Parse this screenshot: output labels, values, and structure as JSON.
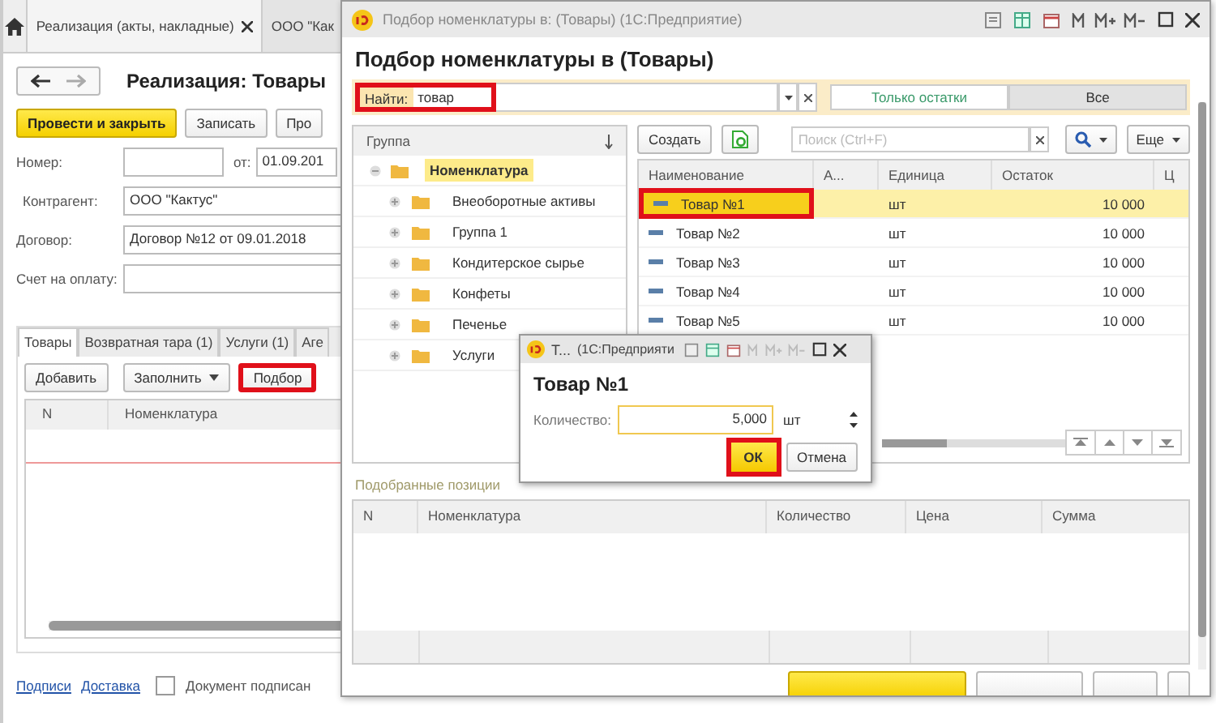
{
  "main_window": {
    "tabs": [
      {
        "label": "Реализация (акты, накладные)",
        "selected": true
      },
      {
        "label": "ООО \"Как",
        "selected": false
      }
    ],
    "title": "Реализация: Товары",
    "buttons": [
      {
        "label": "Провести и закрыть",
        "kind": "primary"
      },
      {
        "label": "Записать",
        "kind": "normal"
      },
      {
        "label": "Про",
        "kind": "normal"
      }
    ],
    "number": {
      "label": "Номер:"
    },
    "date": {
      "label": "от:",
      "value": "01.09.201"
    },
    "counterparty": {
      "label": "Контрагент:",
      "value": "ООО \"Кактус\""
    },
    "contract": {
      "label": "Договор:",
      "value": "Договор №12 от 09.01.2018"
    },
    "invoice": {
      "label": "Счет на оплату:"
    },
    "doc_tabs": [
      {
        "label": "Товары",
        "selected": true
      },
      {
        "label": "Возвратная тара (1)",
        "selected": false
      },
      {
        "label": "Услуги (1)",
        "selected": false
      },
      {
        "label": "Аге",
        "selected": false
      }
    ],
    "toolbar": [
      {
        "label": "Добавить",
        "dropdown": false,
        "highlighted": false
      },
      {
        "label": "Заполнить",
        "dropdown": true,
        "highlighted": false
      },
      {
        "label": "Подбор",
        "dropdown": false,
        "highlighted": true
      }
    ],
    "table": {
      "columns": [
        "N",
        "Номенклатура"
      ]
    },
    "links": [
      "Подписи",
      "Доставка"
    ],
    "signed": {
      "label": "Документ подписан",
      "checked": false
    }
  },
  "picker": {
    "window_title": "Подбор номенклатуры в: (Товары) (1С:Предприятие)",
    "title": "Подбор номенклатуры в  (Товары)",
    "find": {
      "label": "Найти:",
      "value": "товар",
      "highlighted": true
    },
    "filters": [
      {
        "label": "Только остатки",
        "selected": false
      },
      {
        "label": "Все",
        "selected": true
      }
    ],
    "groups": {
      "header": "Группа",
      "tree": [
        {
          "label": "Номенклатура",
          "selected": true,
          "expanded": true,
          "children": [
            {
              "label": "Внеоборотные активы",
              "selected": false,
              "expanded": false
            },
            {
              "label": "Группа 1",
              "selected": false,
              "expanded": false
            },
            {
              "label": "Кондитерское сырье",
              "selected": false,
              "expanded": false
            },
            {
              "label": "Конфеты",
              "selected": false,
              "expanded": false
            },
            {
              "label": "Печенье",
              "selected": false,
              "expanded": false
            },
            {
              "label": "Услуги",
              "selected": false,
              "expanded": false
            }
          ]
        }
      ]
    },
    "create": "Создать",
    "search_placeholder": "Поиск (Ctrl+F)",
    "more": "Еще",
    "columns": [
      "Наименование",
      "А...",
      "Единица",
      "Остаток",
      "Ц"
    ],
    "rows": [
      {
        "name": "Товар №1",
        "unit": "шт",
        "stock": "10 000",
        "selected": true,
        "highlighted": true
      },
      {
        "name": "Товар №2",
        "unit": "шт",
        "stock": "10 000",
        "selected": false,
        "highlighted": false
      },
      {
        "name": "Товар №3",
        "unit": "шт",
        "stock": "10 000",
        "selected": false,
        "highlighted": false
      },
      {
        "name": "Товар №4",
        "unit": "шт",
        "stock": "10 000",
        "selected": false,
        "highlighted": false
      },
      {
        "name": "Товар №5",
        "unit": "шт",
        "stock": "10 000",
        "selected": false,
        "highlighted": false
      }
    ],
    "picked_label": "Подобранные позиции",
    "picked_columns": [
      "N",
      "Номенклатура",
      "Количество",
      "Цена",
      "Сумма"
    ]
  },
  "dialog": {
    "title": "Т...",
    "app": "(1С:Предприяти",
    "heading": "Товар №1",
    "quantity": {
      "label": "Количество:",
      "value": "5,000",
      "unit": "шт"
    },
    "ok": {
      "label": "ОК",
      "highlighted": true
    },
    "cancel": "Отмена"
  }
}
